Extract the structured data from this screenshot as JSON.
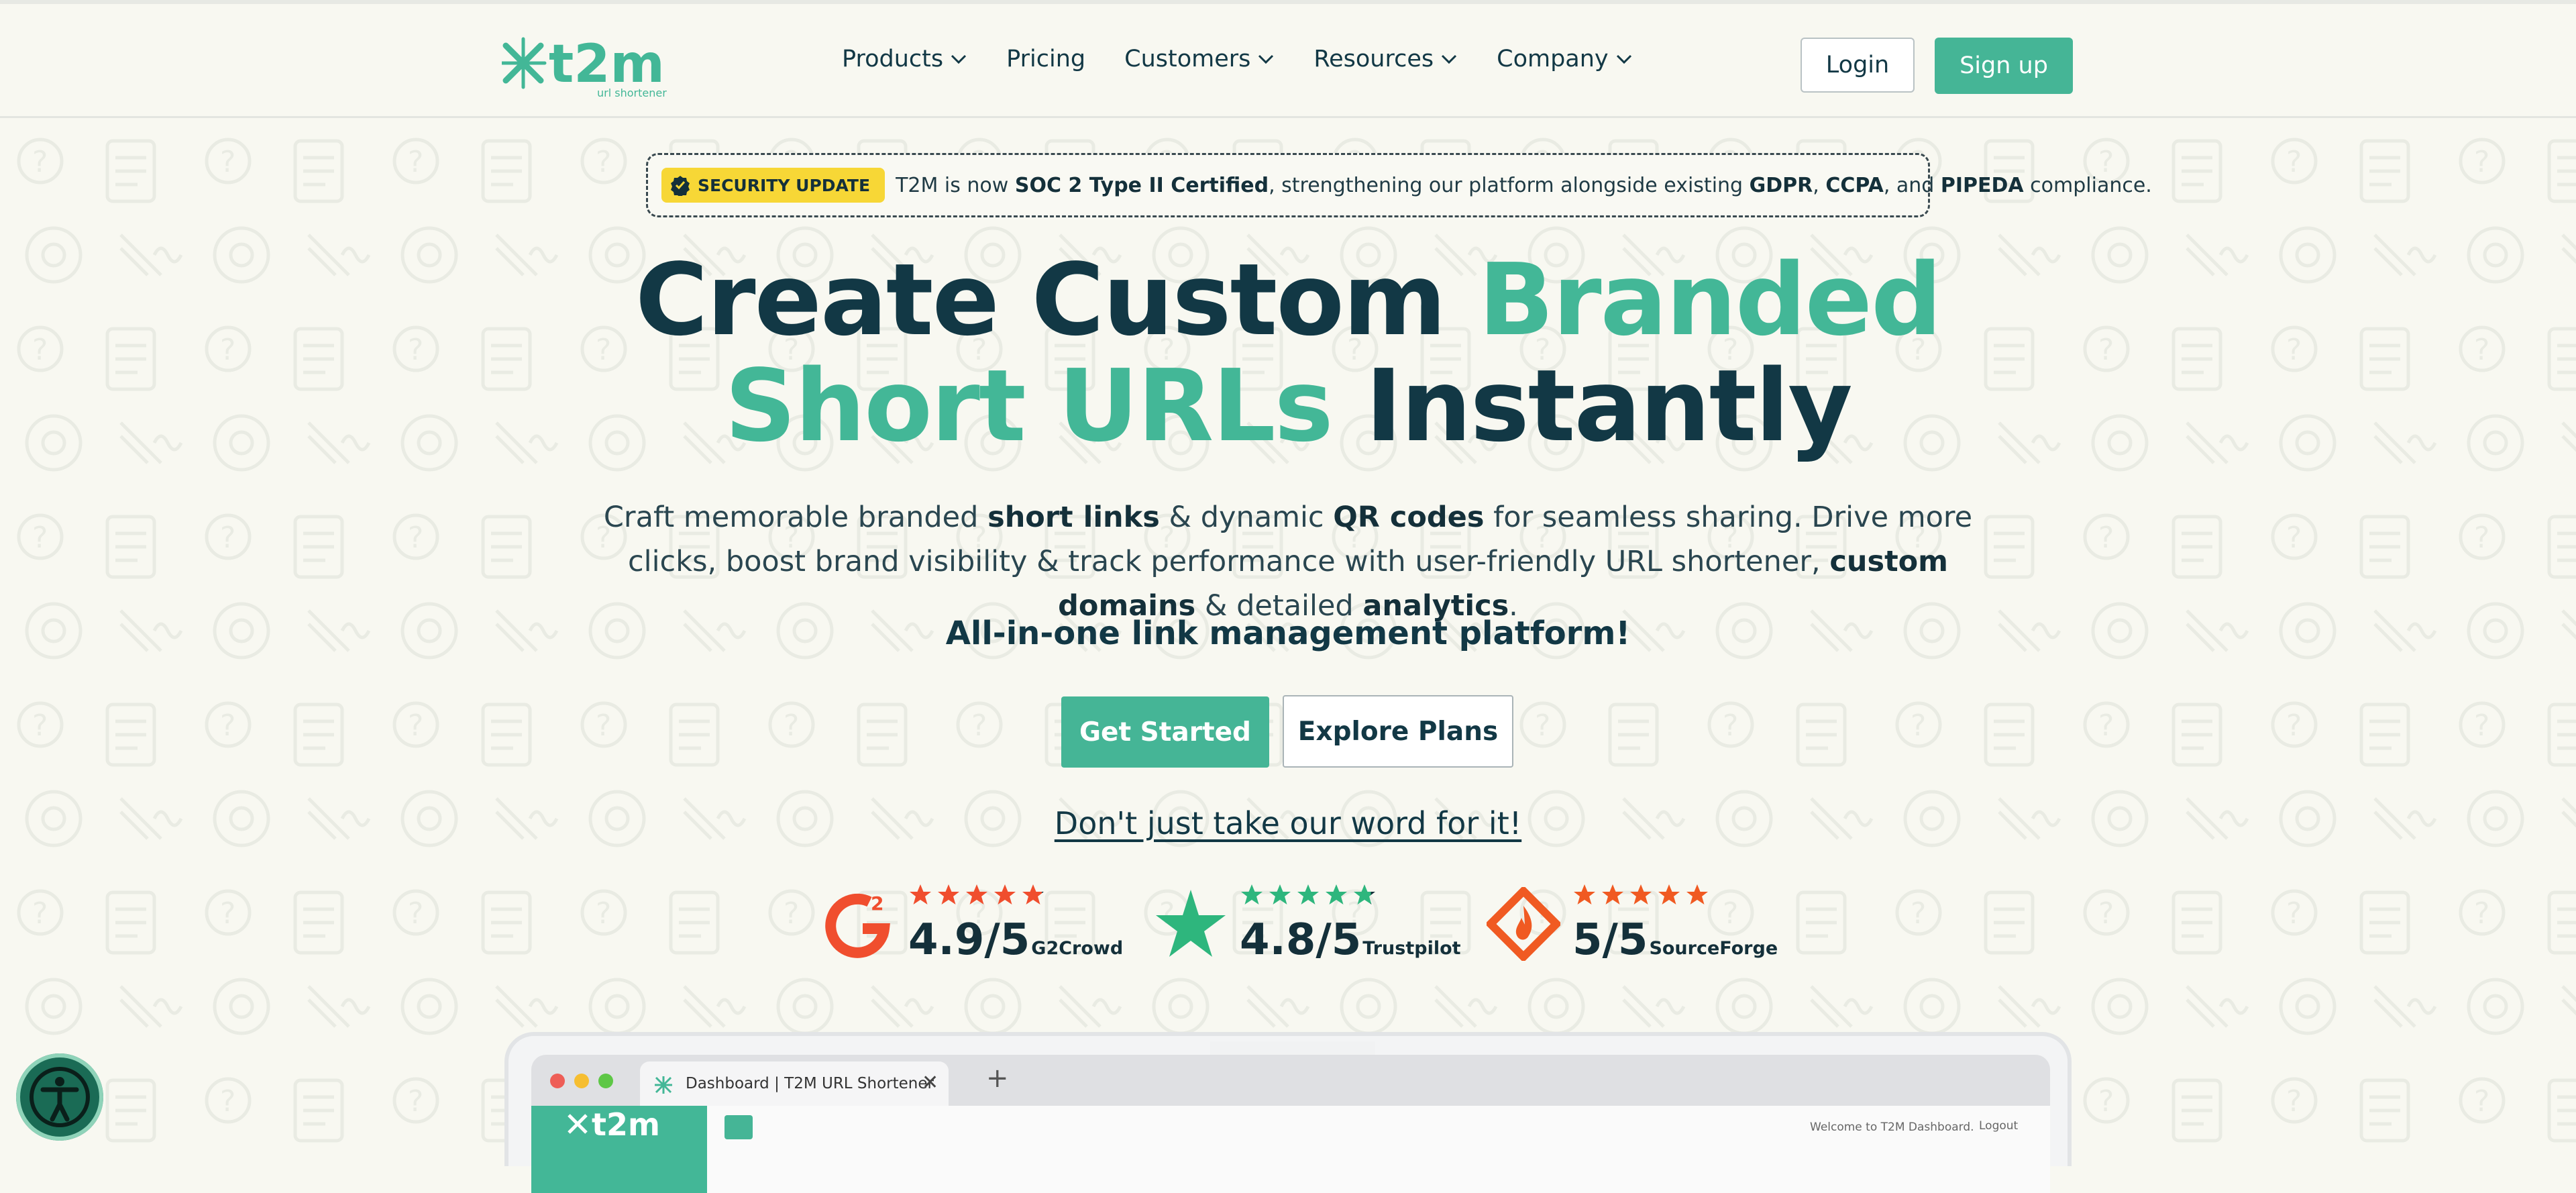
{
  "nav": {
    "logo_text": "t2m",
    "logo_subtext": "url shortener",
    "links": [
      "Products",
      "Pricing",
      "Customers",
      "Resources",
      "Company"
    ],
    "login": "Login",
    "signup": "Sign up"
  },
  "banner": {
    "badge": "SECURITY UPDATE",
    "t1": "T2M is now ",
    "b1": "SOC 2 Type II Certified",
    "t2": ", strengthening our platform alongside existing ",
    "b2": "GDPR",
    "t3": ", ",
    "b3": "CCPA",
    "t4": ", and ",
    "b4": "PIPEDA",
    "t5": " compliance."
  },
  "hero": {
    "line1_dark": "Create Custom ",
    "line1_accent": "Branded",
    "line2_accent": "Short URLs",
    "line2_dark": " Instantly",
    "sub": {
      "s1": "Craft memorable branded ",
      "b1": "short links",
      "s2": " & dynamic ",
      "b2": "QR codes",
      "s3": " for seamless sharing. Drive more clicks, boost brand visibility & track performance with user-friendly URL shortener, ",
      "b3": "custom domains",
      "s4": " & detailed ",
      "b4": "analytics",
      "s5": "."
    },
    "tagline": "All-in-one link management platform!",
    "cta_primary": "Get Started",
    "cta_secondary": "Explore Plans",
    "proof_link": "Don't just take our word for it!"
  },
  "ratings": [
    {
      "score": "4.9/5",
      "source": "G2Crowd",
      "stars": 4.9,
      "color": "#f04e2e"
    },
    {
      "score": "4.8/5",
      "source": "Trustpilot",
      "stars": 4.8,
      "color": "#2eb67d"
    },
    {
      "score": "5/5",
      "source": "SourceForge",
      "stars": 5,
      "color": "#f05a22"
    }
  ],
  "mockup": {
    "tab_title": "Dashboard | T2M URL Shortener",
    "tab_close": "✕",
    "tab_new": "+",
    "dash_logo_text": "t2m",
    "welcome": "Welcome to T2M Dashboard.",
    "logout": "Logout"
  },
  "colors": {
    "accent": "#45b596",
    "dark": "#123845",
    "badge": "#f7d736",
    "background": "#f8f8f1"
  },
  "icons": {
    "accessibility": "accessibility-icon",
    "chevron": "chevron-down-icon"
  }
}
